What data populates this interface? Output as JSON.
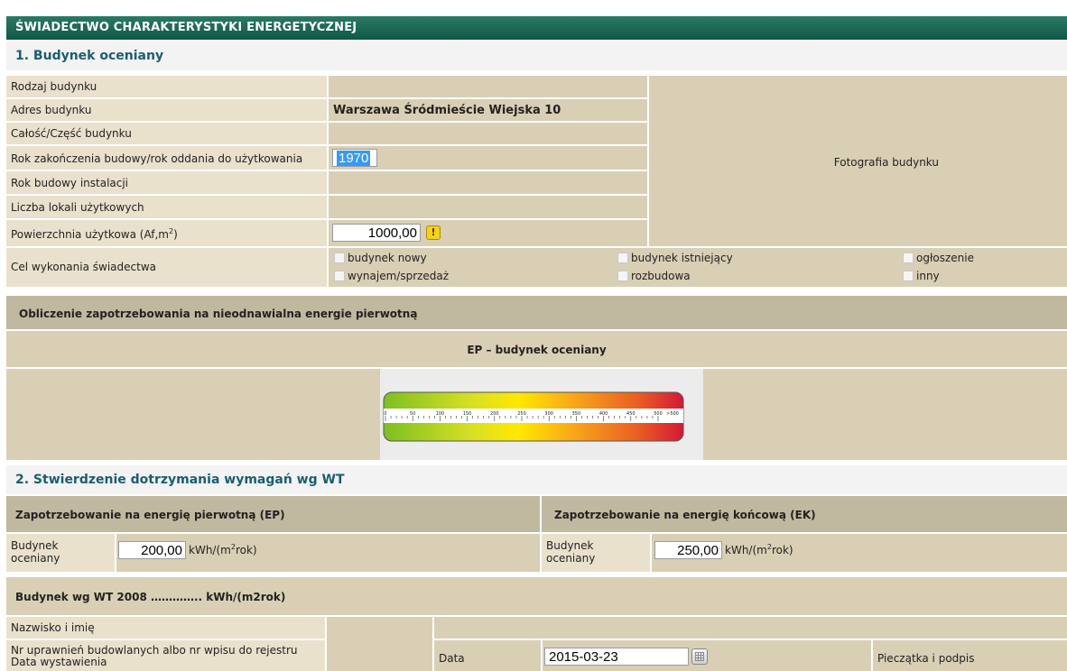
{
  "title": "ŚWIADECTWO CHARAKTERYSTYKI ENERGETYCZNEJ",
  "section1": {
    "heading": "1. Budynek oceniany",
    "rows": {
      "rodzaj": "Rodzaj budynku",
      "adres": "Adres budynku",
      "adres_value": "Warszawa Śródmieście Wiejska 10",
      "calosc": "Całość/Część budynku",
      "rok_zakonczenia": "Rok zakończenia budowy/rok oddania do użytkowania",
      "rok_value": "1970",
      "rok_instalacji": "Rok budowy instalacji",
      "liczba_lokali": "Liczba lokali użytkowych",
      "powierzchnia_prefix": "Powierzchnia użytkowa (Af,m",
      "powierzchnia_sup": "2",
      "powierzchnia_suffix": ")",
      "powierzchnia_value": "1000,00",
      "warn_glyph": "!",
      "cel": "Cel wykonania świadectwa"
    },
    "photo_label": "Fotografia budynku",
    "purpose_options": [
      "budynek nowy",
      "budynek istniejący",
      "ogłoszenie",
      "wynajem/sprzedaż",
      "rozbudowa",
      "inny"
    ]
  },
  "ep_calc": {
    "header": "Obliczenie zapotrzebowania na nieodnawialna energie pierwotną",
    "subheader": "EP – budynek oceniany",
    "scale_ticks": [
      "0",
      "50",
      "100",
      "150",
      "200",
      "250",
      "300",
      "350",
      "400",
      "450",
      "500",
      ">500"
    ]
  },
  "section2": {
    "heading": "2. Stwierdzenie dotrzymania wymagań wg WT",
    "ep_header": "Zapotrzebowanie na energię pierwotną (EP)",
    "ek_header": "Zapotrzebowanie na energię końcową (EK)",
    "budynek_label_1": "Budynek",
    "budynek_label_2": "oceniany",
    "ep_value": "200,00",
    "ek_value": "250,00",
    "unit_prefix": "kWh/(m",
    "unit_sup": "2",
    "unit_suffix": "rok)",
    "wt_line": "Budynek wg WT 2008 ………….. kWh/(m2rok)"
  },
  "signature": {
    "nazwisko": "Nazwisko i imię",
    "nr_uprawnien": "Nr uprawnień budowlanych albo nr wpisu do rejestru",
    "data_wystawienia": "Data wystawienia",
    "data_label": "Data",
    "date_value": "2015-03-23",
    "pieczatka": "Pieczątka i podpis"
  },
  "colors": {
    "title_bg": "#0f5847",
    "cell_bg": "#d9cfb5",
    "label_bg": "#e9e1cc",
    "dark_bg": "#c1b8a0",
    "heading_text": "#1a5d73"
  }
}
